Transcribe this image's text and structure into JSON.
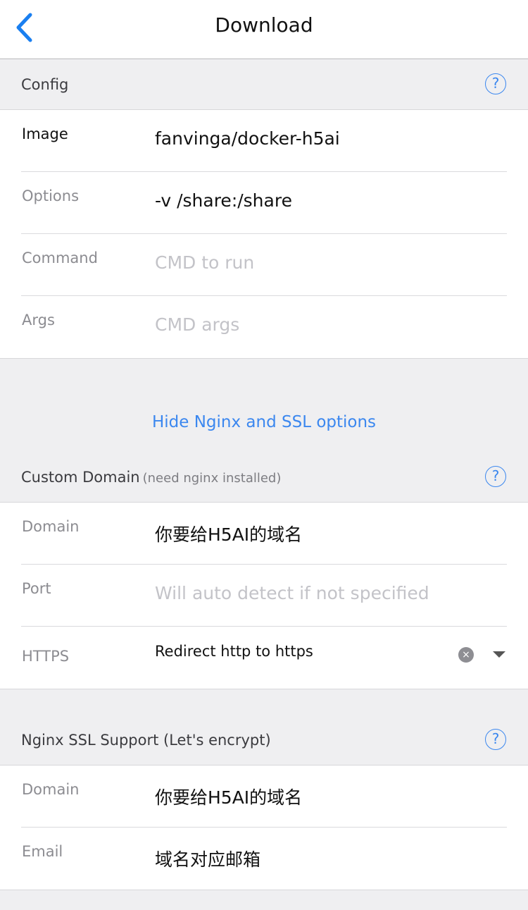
{
  "nav": {
    "title": "Download"
  },
  "config": {
    "header": "Config",
    "help": "?",
    "rows": [
      {
        "label": "Image",
        "value": "fanvinga/docker-h5ai",
        "placeholder": ""
      },
      {
        "label": "Options",
        "value": "-v /share:/share",
        "placeholder": ""
      },
      {
        "label": "Command",
        "value": "",
        "placeholder": "CMD to run"
      },
      {
        "label": "Args",
        "value": "",
        "placeholder": "CMD args"
      }
    ]
  },
  "toggle_link": "Hide Nginx and SSL options",
  "custom_domain": {
    "header": "Custom Domain",
    "header_note": "(need nginx installed)",
    "help": "?",
    "rows": [
      {
        "label": "Domain",
        "value": "你要给H5AI的域名",
        "placeholder": ""
      },
      {
        "label": "Port",
        "value": "",
        "placeholder": "Will auto detect if not specified"
      },
      {
        "label": "HTTPS",
        "value": "Redirect http to https",
        "placeholder": ""
      }
    ],
    "clear_icon": "×"
  },
  "ssl": {
    "header": "Nginx SSL Support (Let's encrypt)",
    "help": "?",
    "rows": [
      {
        "label": "Domain",
        "value": "你要给H5AI的域名",
        "placeholder": ""
      },
      {
        "label": "Email",
        "value": "域名对应邮箱",
        "placeholder": ""
      }
    ]
  },
  "colors": {
    "accent": "#3b87ef",
    "background": "#efeff1"
  }
}
